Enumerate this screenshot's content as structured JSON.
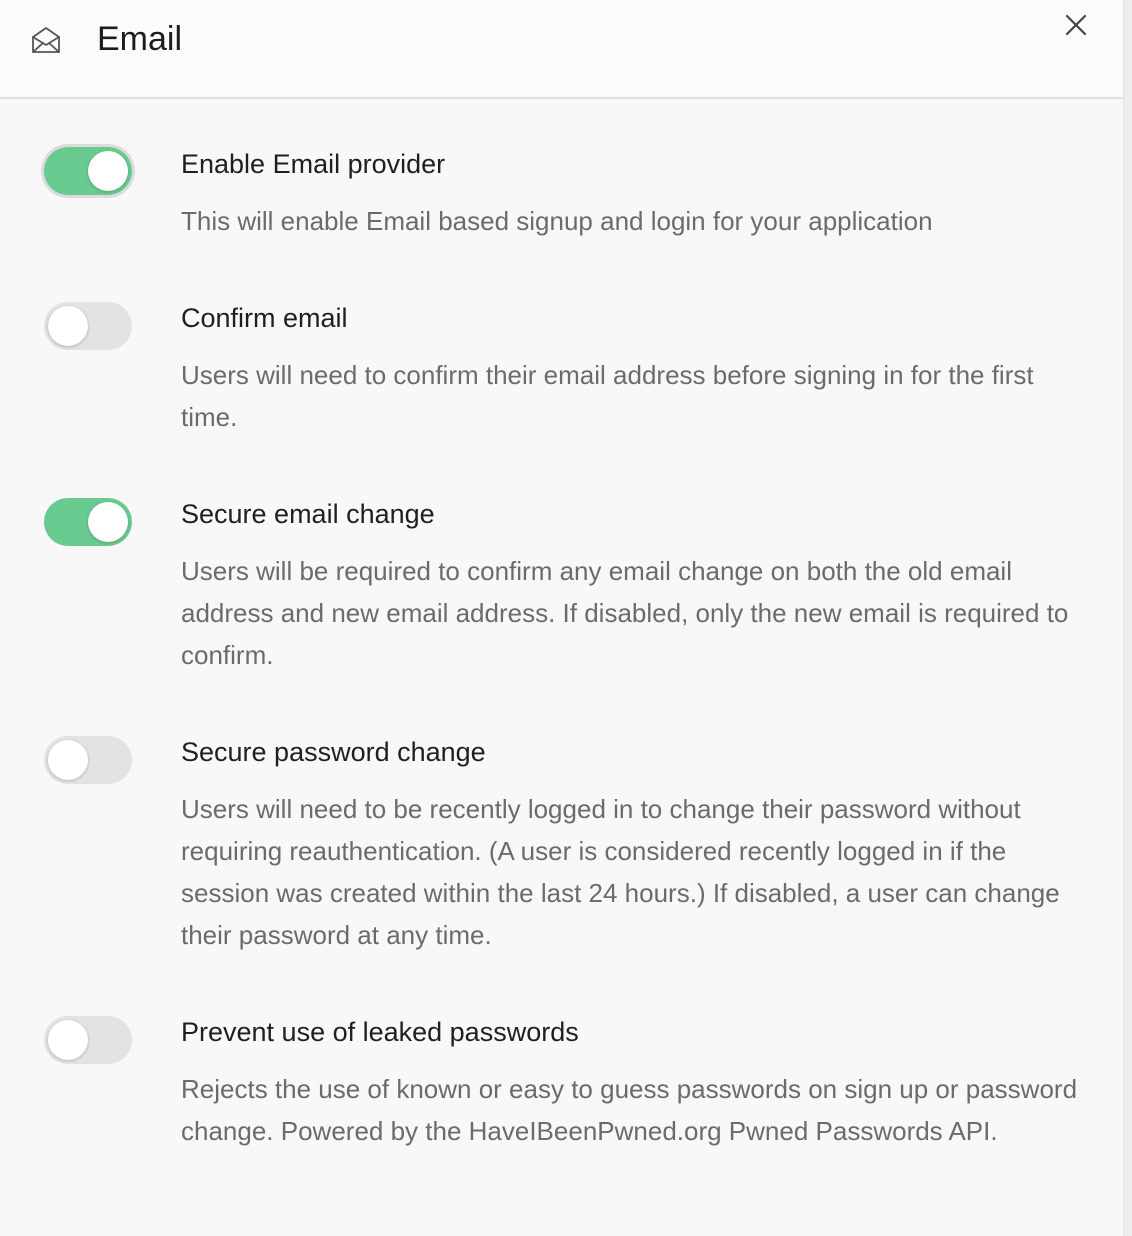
{
  "header": {
    "title": "Email",
    "icon": "envelope-open-icon",
    "close_icon": "close-icon"
  },
  "colors": {
    "toggle_on": "#6acb90",
    "toggle_off": "#e3e3e3"
  },
  "settings": [
    {
      "title": "Enable Email provider",
      "description": "This will enable Email based signup and login for your application",
      "enabled": true
    },
    {
      "title": "Confirm email",
      "description": "Users will need to confirm their email address before signing in for the first time.",
      "enabled": false
    },
    {
      "title": "Secure email change",
      "description": "Users will be required to confirm any email change on both the old email address and new email address. If disabled, only the new email is required to confirm.",
      "enabled": true
    },
    {
      "title": "Secure password change",
      "description": "Users will need to be recently logged in to change their password without requiring reauthentication. (A user is considered recently logged in if the session was created within the last 24 hours.) If disabled, a user can change their password at any time.",
      "enabled": false
    },
    {
      "title": "Prevent use of leaked passwords",
      "description": "Rejects the use of known or easy to guess passwords on sign up or password change. Powered by the HaveIBeenPwned.org Pwned Passwords API.",
      "enabled": false
    }
  ]
}
